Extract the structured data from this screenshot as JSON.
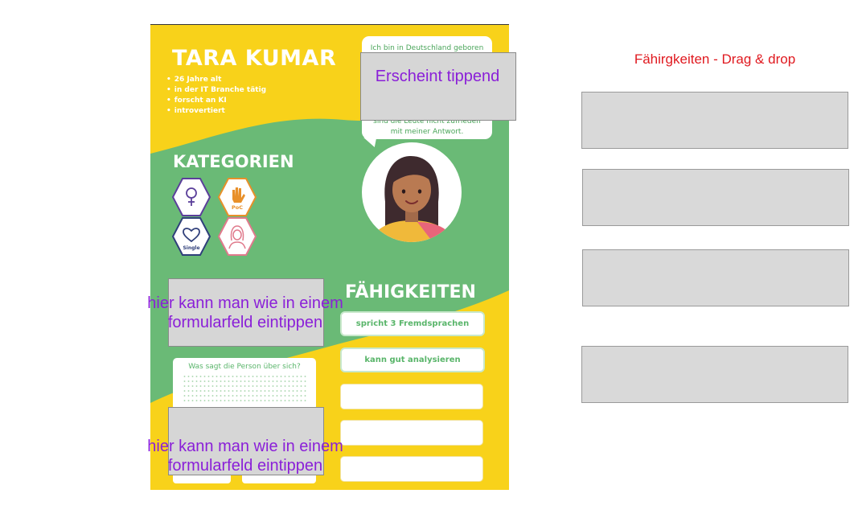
{
  "poster": {
    "name": "TARA KUMAR",
    "facts": [
      "26 Jahre alt",
      "in der IT Branche tätig",
      "forscht an KI",
      "introvertiert"
    ],
    "categories_heading": "KATEGORIEN",
    "categories": [
      {
        "icon": "venus-icon",
        "label": "",
        "color": "#5b3f9a"
      },
      {
        "icon": "raised-hand-icon",
        "label": "PoC",
        "color": "#e8902a"
      },
      {
        "icon": "heart-icon",
        "label": "Single",
        "color": "#2f3f7a"
      },
      {
        "icon": "woman-face-icon",
        "label": "",
        "color": "#e07a8c"
      }
    ],
    "speech_top": "Ich bin in Deutschland geboren",
    "speech_bottom_1": "sind die Leute nicht zufrieden",
    "speech_bottom_2": "mit meiner Antwort.",
    "skills_heading": "FÄHIGKEITEN",
    "skills": [
      "spricht 3 Fremdsprachen",
      "kann gut analysieren"
    ],
    "card_question": "Was sagt die Person über sich?",
    "colors": {
      "yellow": "#f8d21a",
      "green": "#6aba76",
      "purple": "#8a1fd8",
      "red": "#e0191f"
    }
  },
  "overlays": {
    "typing_label": "Erscheint tippend",
    "input_label_1": "hier kann man wie in einem formularfeld eintippen",
    "input_label_2": "hier kann man wie in einem formularfeld eintippen"
  },
  "right_panel": {
    "title": "Fähirgkeiten - Drag & drop",
    "drop_zones": 4
  }
}
